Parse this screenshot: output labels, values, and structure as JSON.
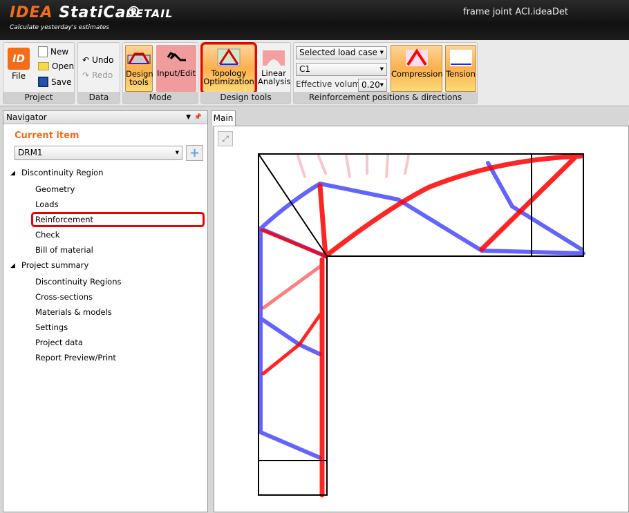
{
  "app": {
    "logo_brand": "IDEA",
    "logo_name": "StatiCa®",
    "product": "DETAIL",
    "tagline": "Calculate yesterday's estimates",
    "document_title": "frame joint ACI.ideaDet"
  },
  "ribbon": {
    "project": {
      "label": "Project",
      "file": "File",
      "new": "New",
      "open": "Open",
      "save": "Save"
    },
    "data": {
      "label": "Data",
      "undo": "Undo",
      "redo": "Redo"
    },
    "mode": {
      "label": "Mode",
      "design_tools": "Design tools",
      "input_edit": "Input/Edit"
    },
    "design_tools": {
      "label": "Design tools",
      "topology": "Topology Optimization",
      "linear": "Linear Analysis"
    },
    "reinforcement": {
      "label": "Reinforcement positions & directions",
      "load_case_mode": "Selected load case",
      "load_case": "C1",
      "effective_volume_label": "Effective volume",
      "effective_volume": "0.20",
      "compression": "Compression",
      "tension": "Tension"
    }
  },
  "navigator": {
    "title": "Navigator",
    "current_item_label": "Current item",
    "current_item": "DRM1",
    "discontinuity_region": "Discontinuity Region",
    "dr_items": [
      "Geometry",
      "Loads",
      "Reinforcement",
      "Check",
      "Bill of material"
    ],
    "project_summary": "Project summary",
    "ps_items": [
      "Discontinuity Regions",
      "Cross-sections",
      "Materials & models",
      "Settings",
      "Project data",
      "Report Preview/Print"
    ]
  },
  "main": {
    "tab": "Main"
  },
  "colors": {
    "compression": "#ff0000",
    "tension": "#2020ff",
    "accent": "#f26c1a"
  }
}
